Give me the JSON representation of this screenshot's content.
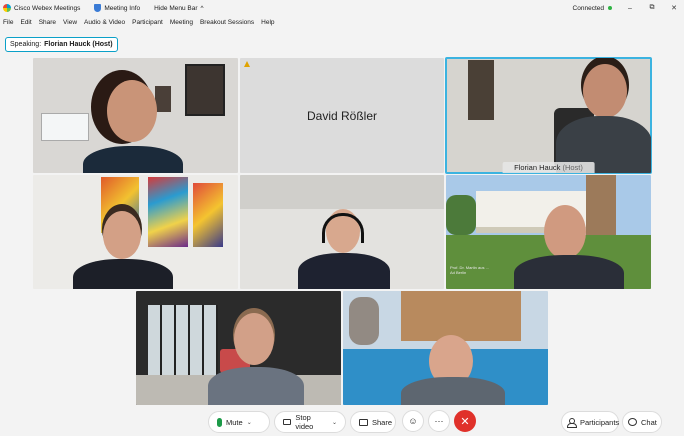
{
  "window": {
    "app_title": "Cisco Webex Meetings",
    "meeting_info": "Meeting Info",
    "hide_menu_bar": "Hide Menu Bar",
    "hide_menu_chevron": "^",
    "status": "Connected",
    "minimize": "–",
    "restore": "⧉",
    "close": "✕"
  },
  "menu": [
    "File",
    "Edit",
    "Share",
    "View",
    "Audio & Video",
    "Participant",
    "Meeting",
    "Breakout Sessions",
    "Help"
  ],
  "speaking": {
    "label": "Speaking:",
    "name": "Florian Hauck (Host)"
  },
  "tiles": {
    "david_name": "David Rößler",
    "florian_name": "Florian Hauck",
    "florian_role": "(Host)",
    "overlay_line1": "Prof. Dr. Martin aus ...",
    "overlay_line2": "Ad Berlin"
  },
  "toolbar": {
    "mute": "Mute",
    "stop_video": "Stop video",
    "share": "Share",
    "reactions": "☺",
    "more": "···",
    "end": "✕",
    "participants": "Participants",
    "chat": "Chat",
    "chevron": "⌄"
  },
  "colors": {
    "accent": "#0aa0c8",
    "end": "#e0312a",
    "connected": "#2fb344"
  }
}
